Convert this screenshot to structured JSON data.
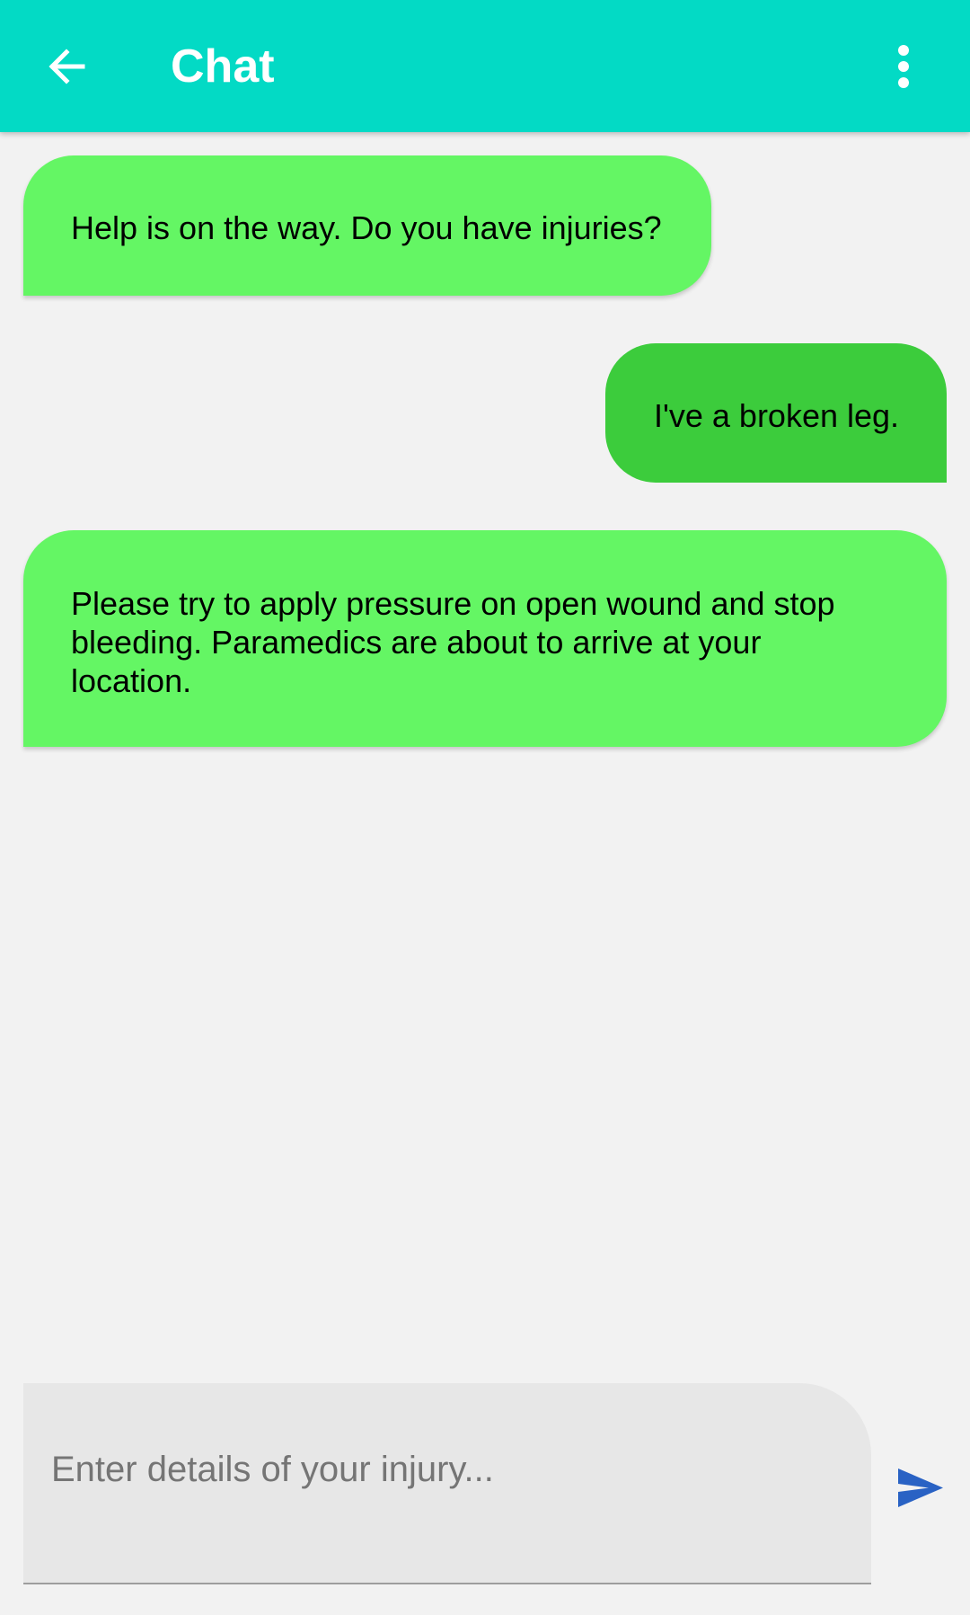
{
  "app_bar": {
    "title": "Chat",
    "back_icon": "arrow-back-icon",
    "overflow_icon": "more-vertical-icon",
    "background": "#03dac5"
  },
  "messages": [
    {
      "sender": "responder",
      "text": "Help is on the way. Do you have injuries?"
    },
    {
      "sender": "user",
      "text": "I've a broken leg."
    },
    {
      "sender": "responder",
      "text": "Please try to apply pressure on open wound and stop bleeding. Paramedics are about to arrive at your location."
    }
  ],
  "composer": {
    "value": "",
    "placeholder": "Enter details of your injury...",
    "send_icon": "send-icon",
    "send_color": "#2962c4"
  },
  "colors": {
    "incoming_bubble": "#64f664",
    "outgoing_bubble": "#3ccc3c",
    "background": "#f2f2f2"
  }
}
